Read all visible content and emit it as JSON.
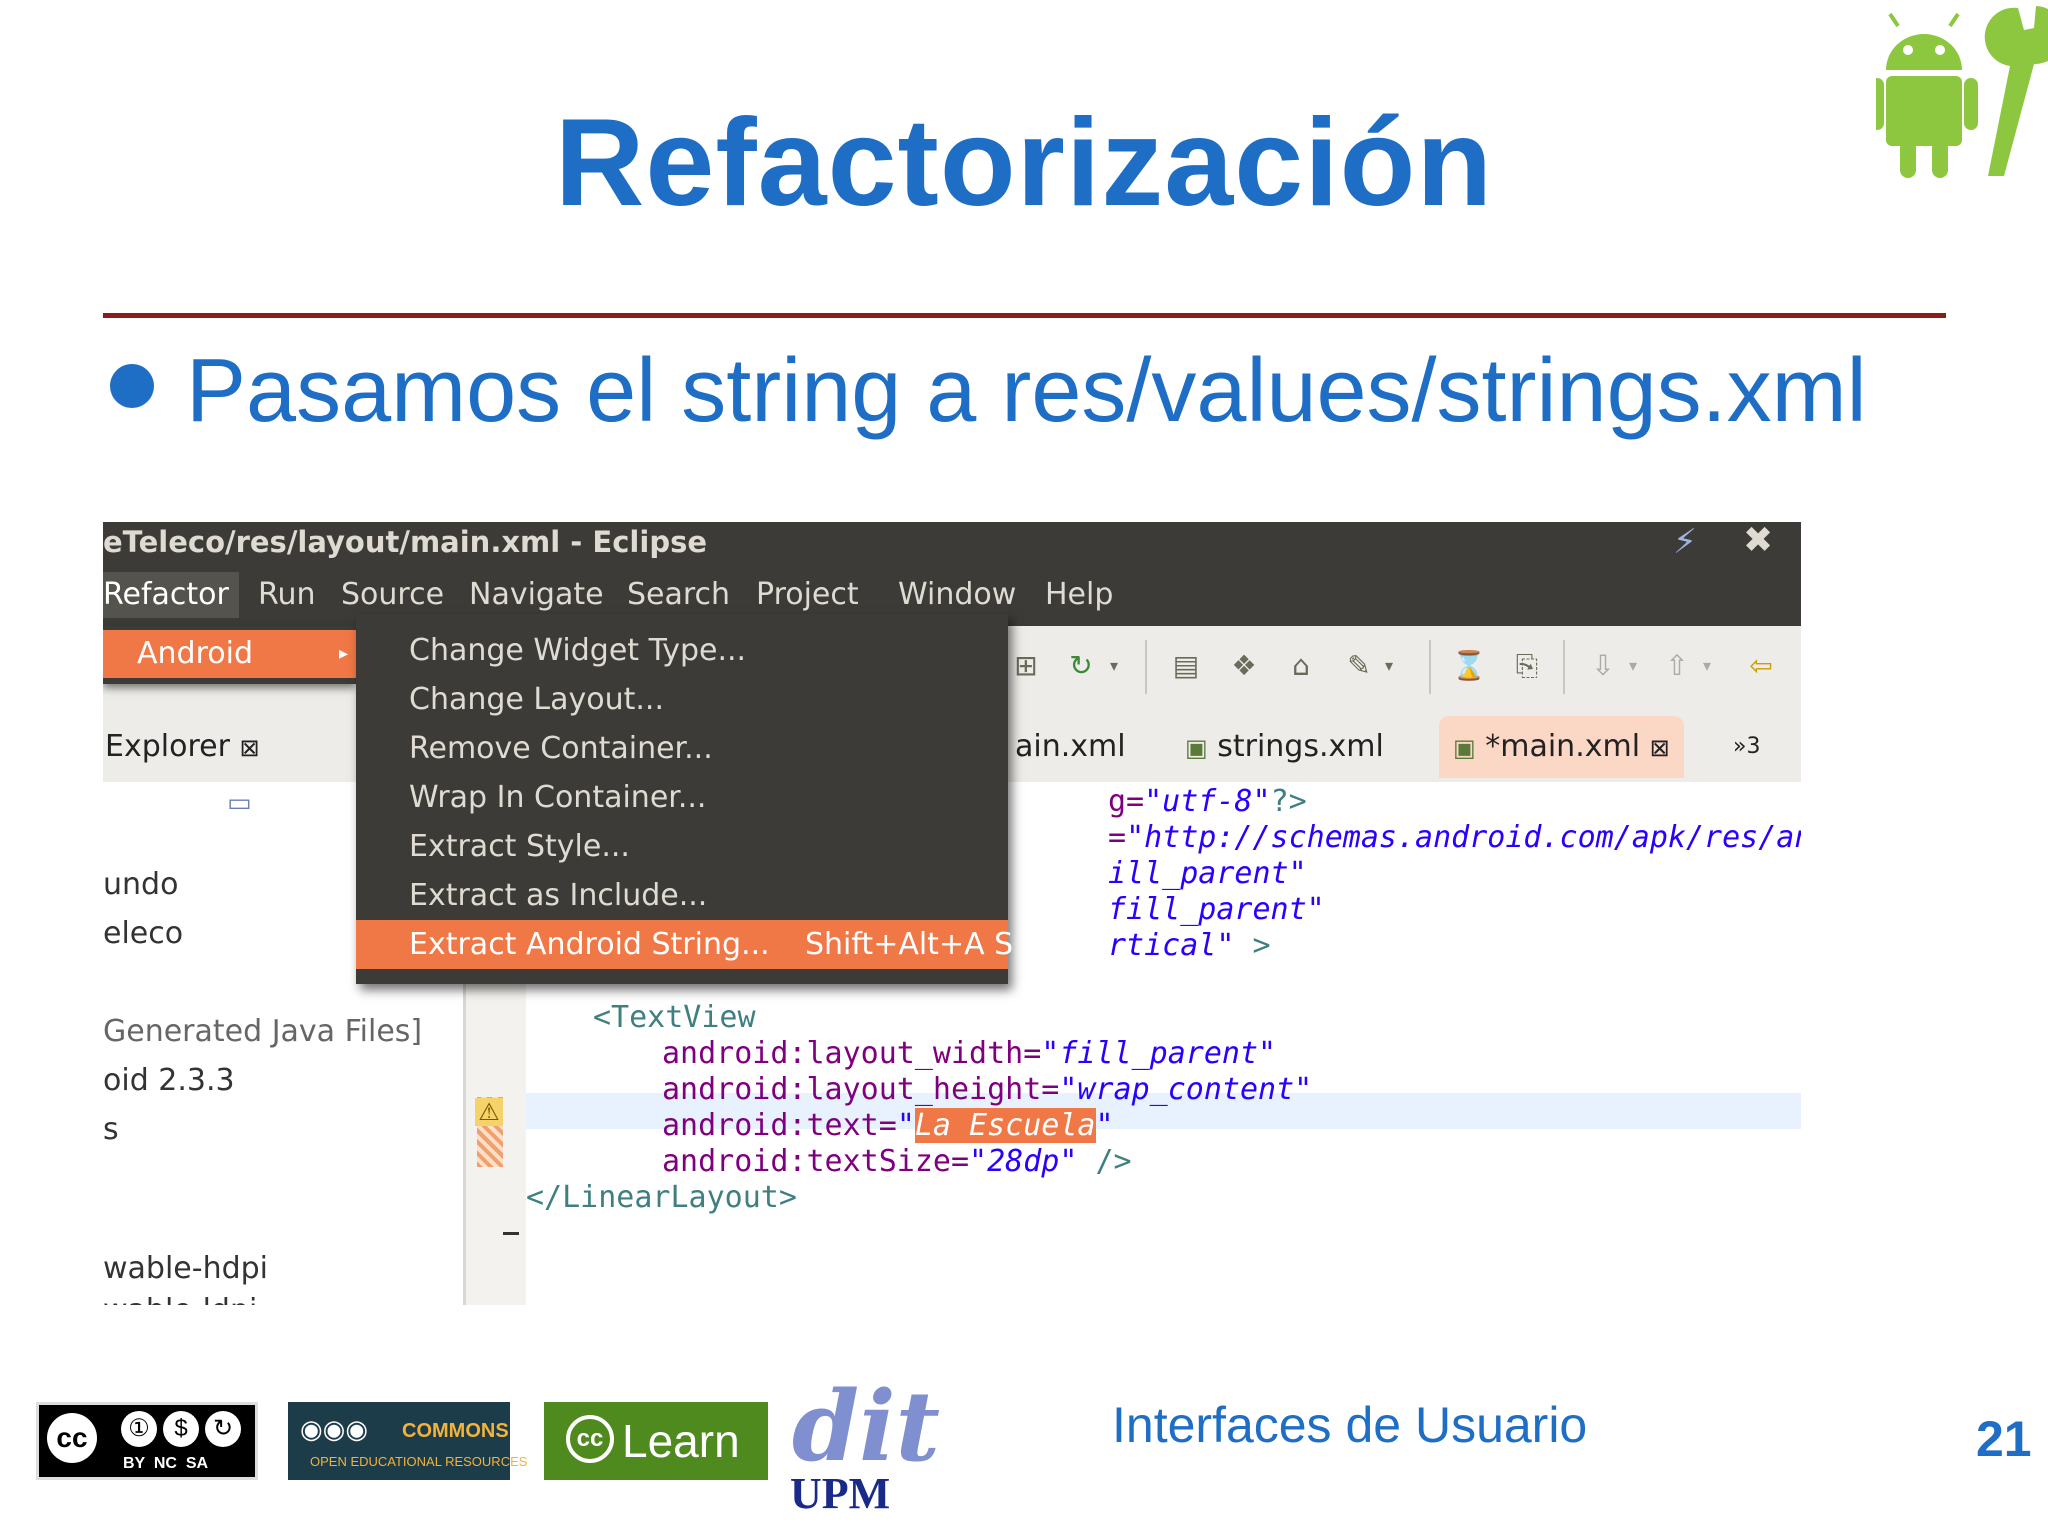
{
  "slide": {
    "title": "Refactorización",
    "bullet": "Pasamos el string a res/values/strings.xml",
    "footer_text": "Interfaces de Usuario",
    "page_number": "21"
  },
  "window": {
    "title": "eTeleco/res/layout/main.xml - Eclipse"
  },
  "menubar": [
    "Refactor",
    "Run",
    "Source",
    "Navigate",
    "Search",
    "Project",
    "Window",
    "Help"
  ],
  "refactor_menu": {
    "android_label": "Android"
  },
  "android_menu": [
    {
      "label": "Change Widget Type...",
      "shortcut": ""
    },
    {
      "label": "Change Layout...",
      "shortcut": ""
    },
    {
      "label": "Remove Container...",
      "shortcut": ""
    },
    {
      "label": "Wrap In Container...",
      "shortcut": ""
    },
    {
      "label": "Extract Style...",
      "shortcut": ""
    },
    {
      "label": "Extract as Include...",
      "shortcut": ""
    },
    {
      "label": "Extract Android String...",
      "shortcut": "Shift+Alt+A S"
    }
  ],
  "editor_tabs": {
    "tab1": "ain.xml",
    "tab2": "strings.xml",
    "tab3": "*main.xml",
    "overflow": "»3"
  },
  "explorer": {
    "title": "Explorer",
    "items": [
      "undo",
      "eleco",
      "Generated Java Files]",
      "oid 2.3.3",
      "s",
      "wable-hdpi",
      "wable-ldpi"
    ]
  },
  "code": {
    "line1": {
      "a": "g=",
      "v": "\"utf-8\"",
      "b": "?>"
    },
    "line2": {
      "a": "=",
      "v": "\"http://schemas.android.com/apk/res/android\""
    },
    "line3": {
      "v": "ill_parent\""
    },
    "line4": {
      "v": "fill_parent\""
    },
    "line5": {
      "v": "rtical\"",
      "b": " >"
    },
    "textview": "<TextView",
    "lw_attr": "android:layout_width=",
    "lw_val": "\"fill_parent\"",
    "lh_attr": "android:layout_height=",
    "lh_val": "\"wrap_content\"",
    "text_attr": "android:text=",
    "text_q1": "\"",
    "text_sel": "La Escuela",
    "text_q2": "\"",
    "ts_attr": "android:textSize=",
    "ts_val": "\"28dp\"",
    "ts_end": " />",
    "close": "</LinearLayout>"
  },
  "logos": {
    "cc": "BY  NC  SA",
    "oer_top": "COMMONS",
    "oer_bottom": "OPEN EDUCATIONAL RESOURCES",
    "celearn": "Learn",
    "dit": "dit",
    "upm": "UPM"
  }
}
